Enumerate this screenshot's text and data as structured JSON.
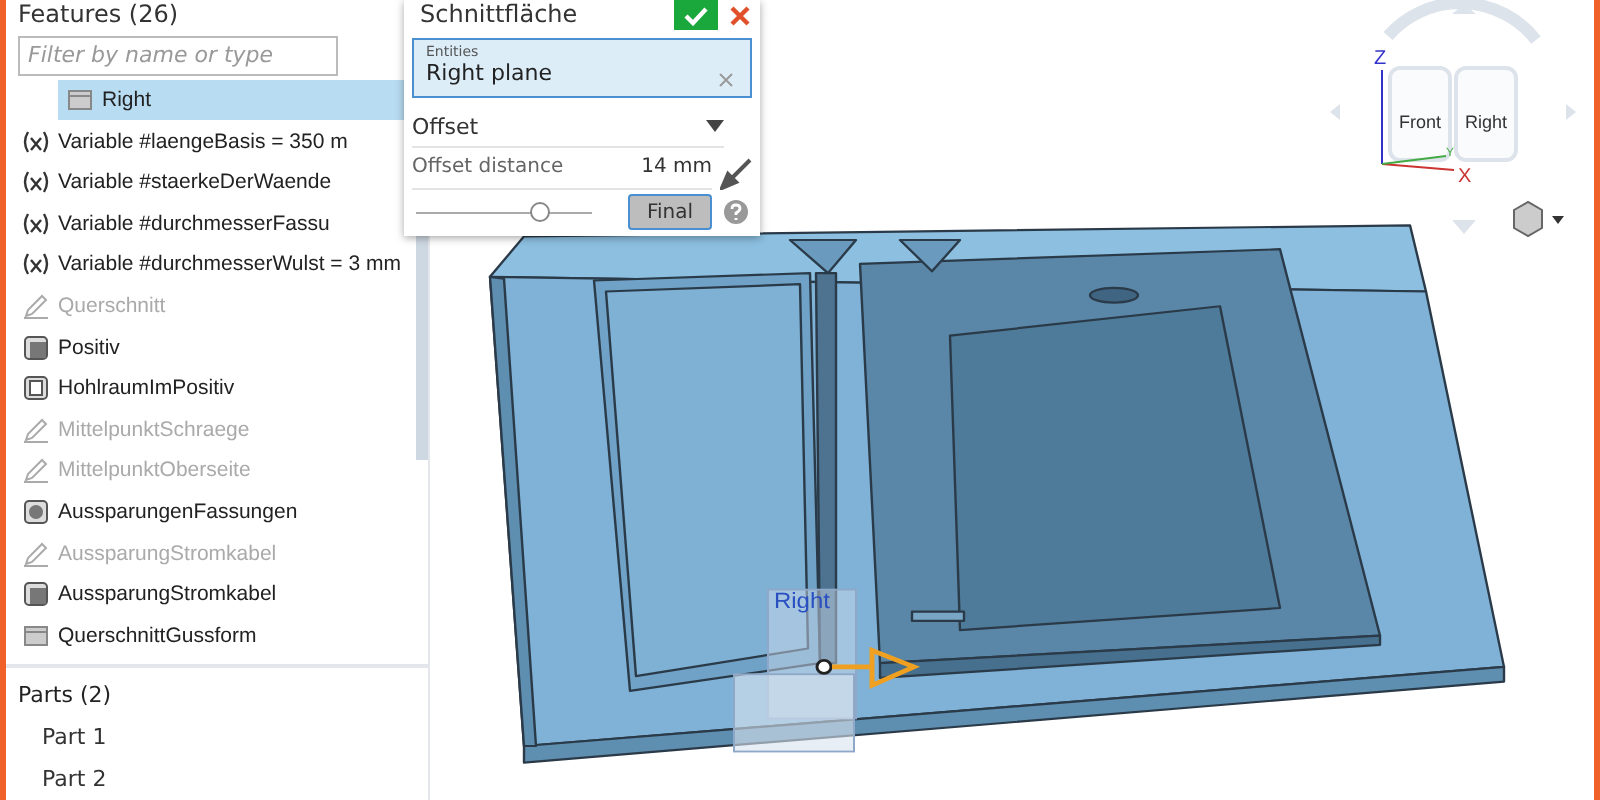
{
  "features_panel": {
    "title": "Features (26)",
    "filter": {
      "placeholder": "Filter by name or type"
    },
    "items": [
      {
        "kind": "plane",
        "label": "Right",
        "selected": true,
        "dimmed": false
      },
      {
        "kind": "variable",
        "label": "Variable #laengeBasis = 350 m",
        "selected": false,
        "dimmed": false
      },
      {
        "kind": "variable",
        "label": "Variable #staerkeDerWaende",
        "selected": false,
        "dimmed": false
      },
      {
        "kind": "variable",
        "label": "Variable #durchmesserFassu",
        "selected": false,
        "dimmed": false
      },
      {
        "kind": "variable",
        "label": "Variable #durchmesserWulst = 3 mm",
        "selected": false,
        "dimmed": false
      },
      {
        "kind": "sketch",
        "label": "Querschnitt",
        "selected": false,
        "dimmed": true
      },
      {
        "kind": "extrude",
        "label": "Positiv",
        "selected": false,
        "dimmed": false
      },
      {
        "kind": "shell",
        "label": "HohlraumImPositiv",
        "selected": false,
        "dimmed": false
      },
      {
        "kind": "sketch",
        "label": "MittelpunktSchraege",
        "selected": false,
        "dimmed": true
      },
      {
        "kind": "sketch",
        "label": "MittelpunktOberseite",
        "selected": false,
        "dimmed": true
      },
      {
        "kind": "revolve",
        "label": "AussparungenFassungen",
        "selected": false,
        "dimmed": false
      },
      {
        "kind": "sketch",
        "label": "AussparungStromkabel",
        "selected": false,
        "dimmed": true
      },
      {
        "kind": "extrude",
        "label": "AussparungStromkabel",
        "selected": false,
        "dimmed": false
      },
      {
        "kind": "plane",
        "label": "QuerschnittGussform",
        "selected": false,
        "dimmed": false
      }
    ]
  },
  "parts_panel": {
    "title": "Parts (2)",
    "items": [
      {
        "label": "Part 1"
      },
      {
        "label": "Part 2"
      }
    ]
  },
  "dialog": {
    "title": "Schnittfläche",
    "entities": {
      "label": "Entities",
      "value": "Right plane"
    },
    "mode": "Offset",
    "distance": {
      "label": "Offset distance",
      "value": "14 mm"
    },
    "final_button": "Final",
    "slider": {
      "level": 0.7
    }
  },
  "viewport": {
    "plane_label": "Right",
    "view_cube": {
      "faces": [
        "Front",
        "Right"
      ],
      "axes": [
        "Z",
        "X",
        "Y"
      ]
    }
  }
}
